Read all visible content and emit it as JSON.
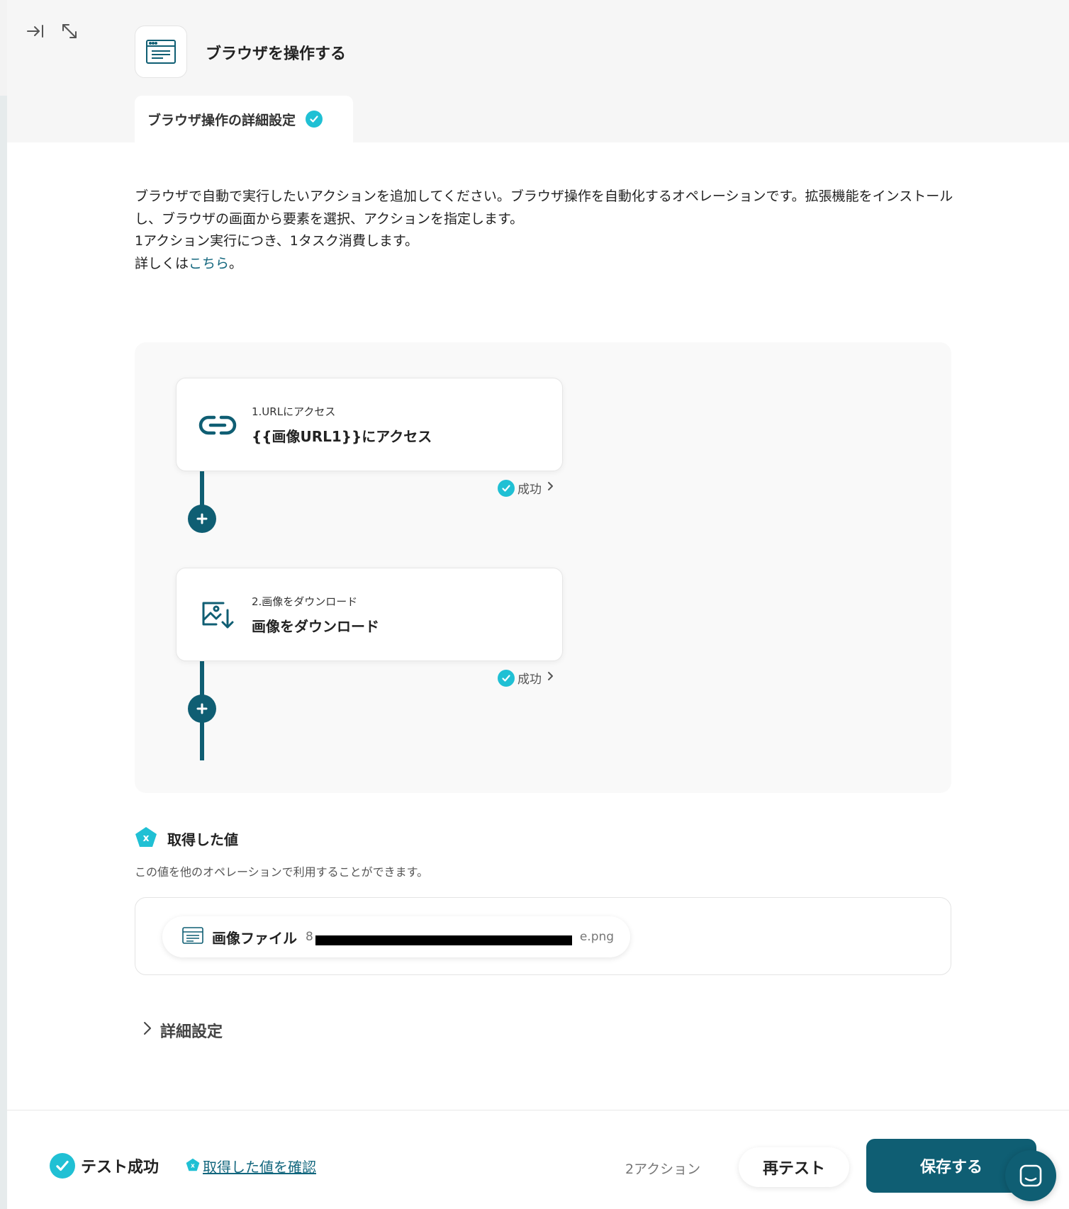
{
  "header": {
    "title": "ブラウザを操作する",
    "tab_label": "ブラウザ操作の詳細設定"
  },
  "description": {
    "line1": "ブラウザで自動で実行したいアクションを追加してください。ブラウザ操作を自動化するオペレーションです。拡張機能をインストールし、ブラウザの画面から要素を選択、アクションを指定します。",
    "line2": "1アクション実行につき、1タスク消費します。",
    "more_prefix": "詳しくは",
    "more_link": "こちら",
    "more_suffix": "。"
  },
  "steps": [
    {
      "subtitle": "1.URLにアクセス",
      "title": "{{画像URL1}}にアクセス",
      "status": "成功",
      "icon": "link-icon"
    },
    {
      "subtitle": "2.画像をダウンロード",
      "title": "画像をダウンロード",
      "status": "成功",
      "icon": "image-download-icon"
    }
  ],
  "values": {
    "heading": "取得した値",
    "note": "この値を他のオペレーションで利用することができます。",
    "chip_label": "画像ファイル",
    "chip_value_prefix": "8",
    "chip_value_suffix": "e.png"
  },
  "details_label": "詳細設定",
  "footer": {
    "test_status": "テスト成功",
    "confirm_link": "取得した値を確認",
    "action_count": "2アクション",
    "retest_label": "再テスト",
    "save_label": "保存する"
  },
  "colors": {
    "primary": "#0f5e73",
    "success": "#20c0d4",
    "link": "#13677e"
  }
}
